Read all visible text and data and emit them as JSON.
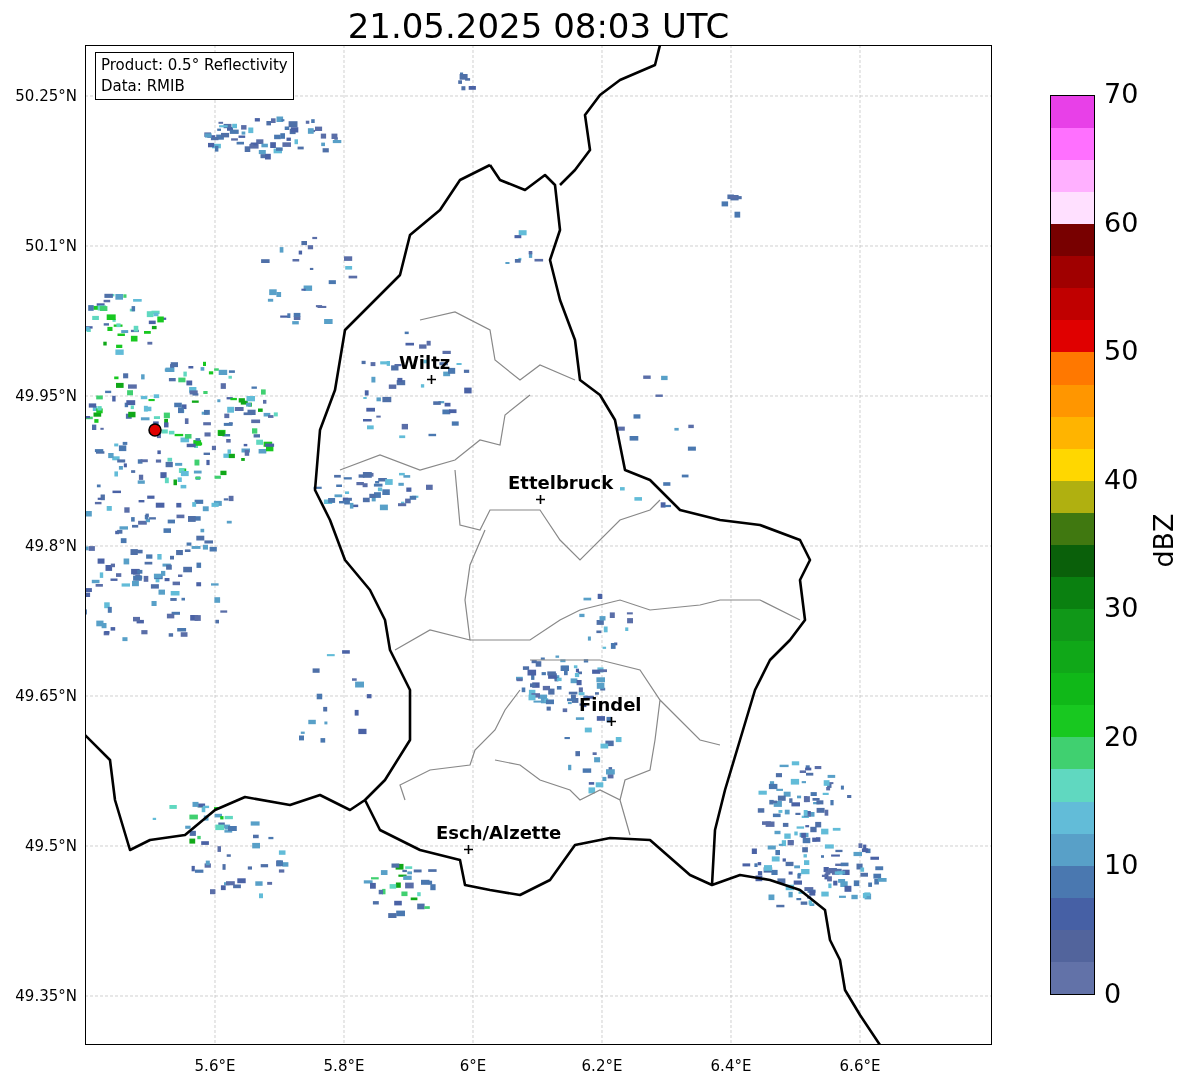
{
  "title": "21.05.2025 08:03 UTC",
  "legend": [
    "Product: 0.5° Reflectivity",
    "Data: RMIB"
  ],
  "map": {
    "lat_ticks": [
      "50.25°N",
      "50.1°N",
      "49.95°N",
      "49.8°N",
      "49.65°N",
      "49.5°N",
      "49.35°N"
    ],
    "lon_ticks": [
      "5.6°E",
      "5.8°E",
      "6°E",
      "6.2°E",
      "6.4°E",
      "6.6°E"
    ],
    "cities": [
      {
        "name": "Wiltz"
      },
      {
        "name": "Ettelbruck"
      },
      {
        "name": "Findel"
      },
      {
        "name": "Esch/Alzette"
      }
    ]
  },
  "colorbar": {
    "label": "dBZ",
    "ticks": [
      "70",
      "60",
      "50",
      "40",
      "30",
      "20",
      "10",
      "0"
    ],
    "segments": [
      {
        "color": "#6272a8"
      },
      {
        "color": "#52649c"
      },
      {
        "color": "#4660a5"
      },
      {
        "color": "#4a78b0"
      },
      {
        "color": "#58a0c8"
      },
      {
        "color": "#62bcd8"
      },
      {
        "color": "#60d8c0"
      },
      {
        "color": "#40d070"
      },
      {
        "color": "#18c820"
      },
      {
        "color": "#10b818"
      },
      {
        "color": "#10a818"
      },
      {
        "color": "#109818"
      },
      {
        "color": "#0a8010"
      },
      {
        "color": "#0a600a"
      },
      {
        "color": "#407810"
      },
      {
        "color": "#b0b010"
      },
      {
        "color": "#ffd700"
      },
      {
        "color": "#ffb400"
      },
      {
        "color": "#ff9600"
      },
      {
        "color": "#ff7800"
      },
      {
        "color": "#e00000"
      },
      {
        "color": "#c00000"
      },
      {
        "color": "#a00000"
      },
      {
        "color": "#780000"
      },
      {
        "color": "#ffe0ff"
      },
      {
        "color": "#ffb0ff"
      },
      {
        "color": "#ff70ff"
      },
      {
        "color": "#e840e8"
      }
    ]
  }
}
